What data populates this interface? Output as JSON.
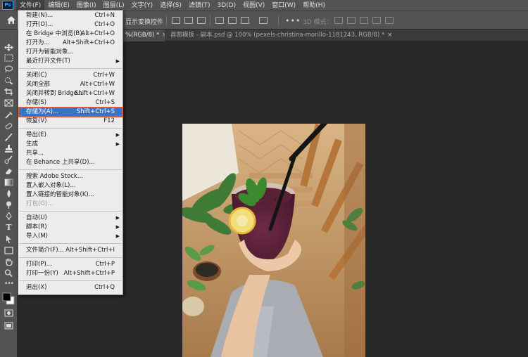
{
  "menubar": {
    "items": [
      "文件(F)",
      "编辑(E)",
      "图像(I)",
      "图层(L)",
      "文字(Y)",
      "选择(S)",
      "滤镜(T)",
      "3D(D)",
      "视图(V)",
      "窗口(W)",
      "帮助(H)"
    ]
  },
  "optionsbar": {
    "show_transform": "显示变换控件",
    "three_d_mode": "3D 模式："
  },
  "tabs": [
    {
      "label": "%(RGB/8) *",
      "close": "×"
    },
    {
      "label": "首图模板 - 副本.psd @ 100% (pexels-christina-morillo-1181243, RGB/8) *",
      "close": "×"
    }
  ],
  "file_menu": {
    "groups": [
      [
        {
          "label": "新建(N)...",
          "shortcut": "Ctrl+N"
        },
        {
          "label": "打开(O)...",
          "shortcut": "Ctrl+O"
        },
        {
          "label": "在 Bridge 中浏览(B)...",
          "shortcut": "Alt+Ctrl+O"
        },
        {
          "label": "打开为...",
          "shortcut": "Alt+Shift+Ctrl+O"
        },
        {
          "label": "打开为智能对象..."
        },
        {
          "label": "最近打开文件(T)",
          "arrow": "▶"
        }
      ],
      [
        {
          "label": "关闭(C)",
          "shortcut": "Ctrl+W"
        },
        {
          "label": "关闭全部",
          "shortcut": "Alt+Ctrl+W"
        },
        {
          "label": "关闭并转到 Bridge...",
          "shortcut": "Shift+Ctrl+W"
        },
        {
          "label": "存储(S)",
          "shortcut": "Ctrl+S"
        },
        {
          "label": "存储为(A)...",
          "shortcut": "Shift+Ctrl+S",
          "highlight": true
        },
        {
          "label": "恢复(V)",
          "shortcut": "F12"
        }
      ],
      [
        {
          "label": "导出(E)",
          "arrow": "▶"
        },
        {
          "label": "生成",
          "arrow": "▶"
        },
        {
          "label": "共享..."
        },
        {
          "label": "在 Behance 上共享(D)..."
        }
      ],
      [
        {
          "label": "搜索 Adobe Stock..."
        },
        {
          "label": "置入嵌入对象(L)..."
        },
        {
          "label": "置入链接的智能对象(K)..."
        },
        {
          "label": "打包(G)...",
          "disabled": true
        }
      ],
      [
        {
          "label": "自动(U)",
          "arrow": "▶"
        },
        {
          "label": "脚本(R)",
          "arrow": "▶"
        },
        {
          "label": "导入(M)",
          "arrow": "▶"
        }
      ],
      [
        {
          "label": "文件简介(F)...",
          "shortcut": "Alt+Shift+Ctrl+I"
        }
      ],
      [
        {
          "label": "打印(P)...",
          "shortcut": "Ctrl+P"
        },
        {
          "label": "打印一份(Y)",
          "shortcut": "Alt+Shift+Ctrl+P"
        }
      ],
      [
        {
          "label": "退出(X)",
          "shortcut": "Ctrl+Q"
        }
      ]
    ]
  }
}
